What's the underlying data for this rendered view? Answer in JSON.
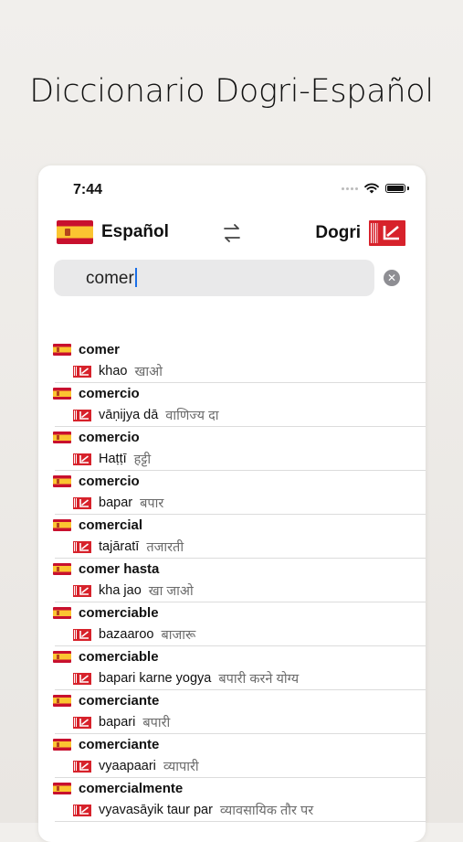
{
  "headline": "Diccionario Dogri-Español",
  "status": {
    "time": "7:44"
  },
  "lang": {
    "source": "Español",
    "target": "Dogri"
  },
  "search": {
    "value": "comer"
  },
  "results": [
    {
      "term": "comer",
      "translit": "khao",
      "deva": "खाओ"
    },
    {
      "term": "comercio",
      "translit": "vāṇijya dā",
      "deva": "वाणिज्य दा"
    },
    {
      "term": "comercio",
      "translit": "Haṭṭī",
      "deva": "हट्टी"
    },
    {
      "term": "comercio",
      "translit": "bapar",
      "deva": "बपार"
    },
    {
      "term": "comercial",
      "translit": "tajāratī",
      "deva": "तजारती"
    },
    {
      "term": "comer hasta",
      "translit": "kha jao",
      "deva": "खा जाओ"
    },
    {
      "term": "comerciable",
      "translit": "bazaaroo",
      "deva": "बाजारू"
    },
    {
      "term": "comerciable",
      "translit": "bapari karne yogya",
      "deva": "बपारी करने योग्य"
    },
    {
      "term": "comerciante",
      "translit": "bapari",
      "deva": "बपारी"
    },
    {
      "term": "comerciante",
      "translit": "vyaapaari",
      "deva": "व्यापारी"
    },
    {
      "term": "comercialmente",
      "translit": "vyavasāyik taur par",
      "deva": "व्यावसायिक तौर पर"
    }
  ]
}
